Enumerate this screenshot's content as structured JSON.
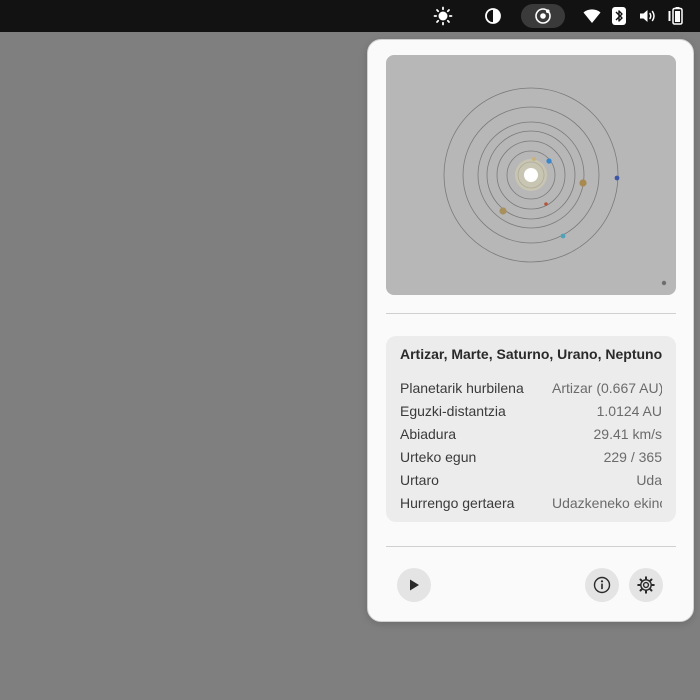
{
  "topbar": {
    "icons": [
      {
        "name": "brightness-icon"
      },
      {
        "name": "contrast-icon"
      },
      {
        "name": "orrery-indicator-icon",
        "active": true
      },
      {
        "name": "wifi-icon"
      },
      {
        "name": "bluetooth-icon"
      },
      {
        "name": "volume-icon"
      },
      {
        "name": "battery-icon"
      }
    ]
  },
  "colors": {
    "desktop": "#7f7f7f",
    "topbar": "#121212",
    "popover": "#fafafa",
    "card": "#ececec",
    "orbit_bg": "#b7b7b7"
  },
  "orrery": {
    "planets": [
      {
        "color": "#c9b27a"
      },
      {
        "color": "#3a86c8"
      },
      {
        "color": "#b5563a"
      },
      {
        "color": "#a88a50"
      },
      {
        "color": "#a8905e"
      },
      {
        "color": "#4fa3b8"
      },
      {
        "color": "#3d56a8"
      }
    ]
  },
  "info": {
    "title": "Artizar, Marte, Saturno, Urano, Neptuno zeruan",
    "rows": [
      {
        "label": "Planetarik hurbilena",
        "value": "Artizar (0.667 AU)"
      },
      {
        "label": "Eguzki-distantzia",
        "value": "1.0124 AU"
      },
      {
        "label": "Abiadura",
        "value": "29.41 km/s"
      },
      {
        "label": "Urteko egun",
        "value": "229 / 365"
      },
      {
        "label": "Urtaro",
        "value": "Uda"
      },
      {
        "label": "Hurrengo gertaera",
        "value": "Udazkeneko ekinokzioa"
      }
    ]
  },
  "controls": {
    "play": {
      "icon": "play-icon"
    },
    "about": {
      "icon": "info-icon"
    },
    "settings": {
      "icon": "gear-icon"
    }
  }
}
